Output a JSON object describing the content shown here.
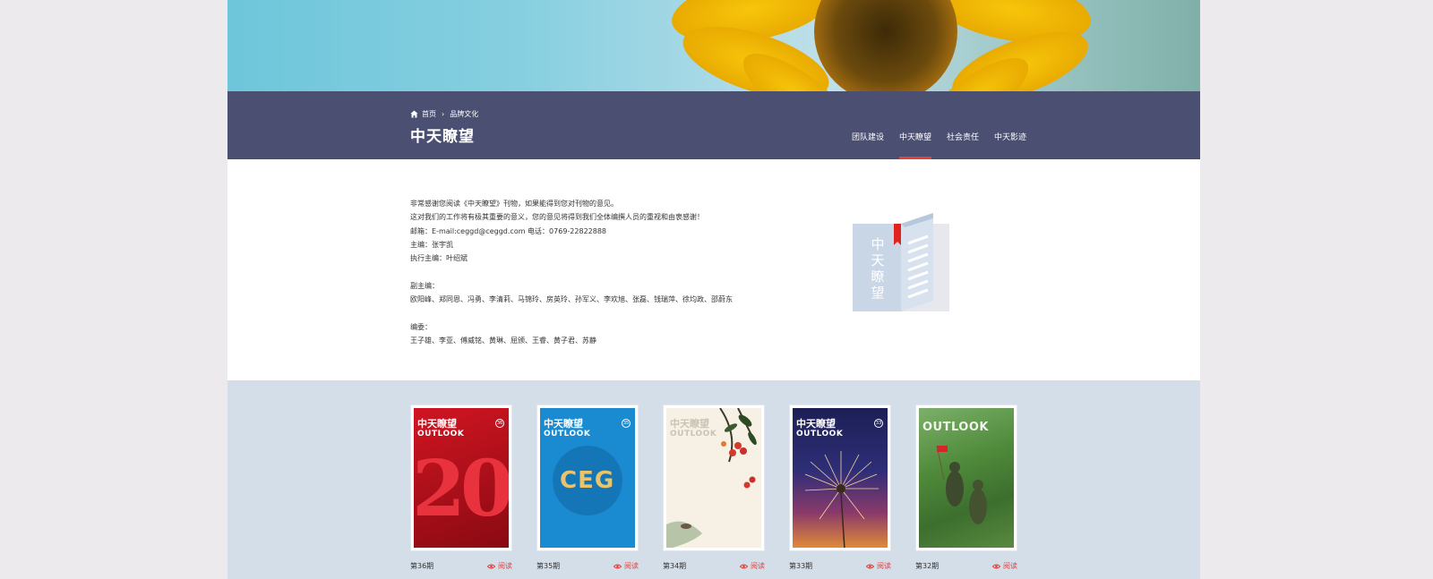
{
  "breadcrumb": {
    "home": "首页",
    "current": "品牌文化"
  },
  "page_title": "中天瞭望",
  "tabs": [
    {
      "label": "团队建设",
      "active": false
    },
    {
      "label": "中天瞭望",
      "active": true
    },
    {
      "label": "社会责任",
      "active": false
    },
    {
      "label": "中天影迹",
      "active": false
    }
  ],
  "intro": {
    "line1": "非常感谢您阅读《中天瞭望》刊物，如果能得到您对刊物的意见。",
    "line2": "这对我们的工作将有极其重要的意义，您的意见将得到我们全体编撰人员的重视和由衷感谢！",
    "line3": "邮箱：E-mail:ceggd@ceggd.com 电话：0769-22822888",
    "line4": "主编：张宇凯",
    "line5": "执行主编：叶绍斌",
    "line6": "副主编：",
    "line7": "欧阳峰、郑同恩、冯勇、李清莉、马锦玲、房英玲、孙军义、李欢旭、张磊、钱瑞萍、徐均政、邵蔚东",
    "line8": "编委：",
    "line9": "王子雄、李亚、傅威铭、黄琳、屈颁、王睿、黄子君、苏静"
  },
  "book_icon_text": "中天瞭望",
  "issues": [
    {
      "label": "第36期",
      "read": "阅读",
      "brand": "中天瞭望",
      "brand_en": "OUTLOOK",
      "num": "36",
      "cover_text": "20",
      "bg": "#b8121d"
    },
    {
      "label": "第35期",
      "read": "阅读",
      "brand": "中天瞭望",
      "brand_en": "OUTLOOK",
      "num": "35",
      "cover_text": "CEG",
      "bg": "#1a8bd0"
    },
    {
      "label": "第34期",
      "read": "阅读",
      "brand": "中天瞭望",
      "brand_en": "OUTLOOK",
      "num": "34",
      "cover_text": "",
      "bg": "#f4efe2"
    },
    {
      "label": "第33期",
      "read": "阅读",
      "brand": "中天瞭望",
      "brand_en": "OUTLOOK",
      "num": "33",
      "cover_text": "",
      "bg": "#2a2e6a"
    },
    {
      "label": "第32期",
      "read": "阅读",
      "brand": "",
      "brand_en": "OUTLOOK",
      "num": "",
      "cover_text": "",
      "bg": "#4f8a3a"
    }
  ],
  "colors": {
    "accent": "#e2403a",
    "titlebar": "#4b4f72",
    "issues_bg": "#d4dee9"
  }
}
